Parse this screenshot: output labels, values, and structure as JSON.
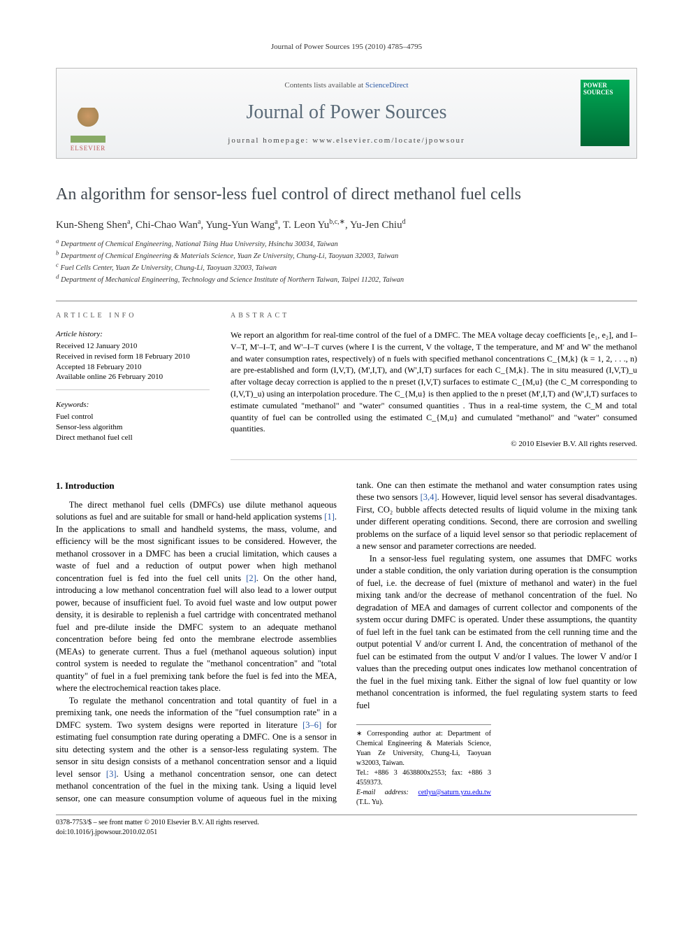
{
  "header": {
    "citation": "Journal of Power Sources 195 (2010) 4785–4795",
    "contents_prefix": "Contents lists available at ",
    "contents_link": "ScienceDirect",
    "journal_name": "Journal of Power Sources",
    "homepage_label": "journal homepage: www.elsevier.com/locate/jpowsour",
    "publisher_logo_text": "ELSEVIER",
    "cover_title": "POWER SOURCES"
  },
  "article": {
    "title": "An algorithm for sensor-less fuel control of direct methanol fuel cells",
    "authors_html": "Kun-Sheng Shen<sup>a</sup>, Chi-Chao Wan<sup>a</sup>, Yung-Yun Wang<sup>a</sup>, T. Leon Yu<sup>b,c,∗</sup>, Yu-Jen Chiu<sup>d</sup>",
    "affiliations": [
      "a Department of Chemical Engineering, National Tsing Hua University, Hsinchu 30034, Taiwan",
      "b Department of Chemical Engineering & Materials Science, Yuan Ze University, Chung-Li, Taoyuan 32003, Taiwan",
      "c Fuel Cells Center, Yuan Ze University, Chung-Li, Taoyuan 32003, Taiwan",
      "d Department of Mechanical Engineering, Technology and Science Institute of Northern Taiwan, Taipei 11202, Taiwan"
    ]
  },
  "info": {
    "heading": "ARTICLE INFO",
    "history_label": "Article history:",
    "history": [
      "Received 12 January 2010",
      "Received in revised form 18 February 2010",
      "Accepted 18 February 2010",
      "Available online 26 February 2010"
    ],
    "keywords_label": "Keywords:",
    "keywords": [
      "Fuel control",
      "Sensor-less algorithm",
      "Direct methanol fuel cell"
    ]
  },
  "abstract": {
    "heading": "ABSTRACT",
    "body": "We report an algorithm for real-time control of the fuel of a DMFC. The MEA voltage decay coefficients [e₁, e₂], and I–V–T, M'–I–T, and W'–I–T curves (where I is the current, V the voltage, T the temperature, and M' and W' the methanol and water consumption rates, respectively) of n fuels with specified methanol concentrations C_{M,k} (k = 1, 2, . . ., n) are pre-established and form (I,V,T), (M',I,T), and (W',I,T) surfaces for each C_{M,k}. The in situ measured (I,V,T)_u after voltage decay correction is applied to the n preset (I,V,T) surfaces to estimate C_{M,u} (the C_M corresponding to (I,V,T)_u) using an interpolation procedure. The C_{M,u} is then applied to the n preset (M',I,T) and (W',I,T) surfaces to estimate cumulated \"methanol\" and \"water\" consumed quantities . Thus in a real-time system, the C_M and total quantity of fuel can be controlled using the estimated C_{M,u} and cumulated \"methanol\" and \"water\" consumed quantities.",
    "copyright": "© 2010 Elsevier B.V. All rights reserved."
  },
  "body": {
    "section1_heading": "1.  Introduction",
    "p1": "The direct methanol fuel cells (DMFCs) use dilute methanol aqueous solutions as fuel and are suitable for small or hand-held application systems [1]. In the applications to small and handheld systems, the mass, volume, and efficiency will be the most significant issues to be considered. However, the methanol crossover in a DMFC has been a crucial limitation, which causes a waste of fuel and a reduction of output power when high methanol concentration fuel is fed into the fuel cell units [2]. On the other hand, introducing a low methanol concentration fuel will also lead to a lower output power, because of insufficient fuel. To avoid fuel waste and low output power density, it is desirable to replenish a fuel cartridge with concentrated methanol fuel and pre-dilute inside the DMFC system to an adequate methanol concentration before being fed onto the membrane electrode assemblies (MEAs) to generate current. Thus a fuel (methanol aqueous solution) input control system is needed to regulate the \"methanol concentration\" and \"total quantity\" of fuel in a fuel premixing tank before the fuel is fed into the MEA, where the electrochemical reaction takes place.",
    "p2": "To regulate the methanol concentration and total quantity of fuel in a premixing tank, one needs the information of the \"fuel consumption rate\" in a DMFC system. Two system designs were reported in literature [3–6] for estimating fuel consumption rate during operating a DMFC. One is a sensor in situ detecting system and the other is a sensor-less regulating system. The sensor in situ design consists of a methanol concentration sensor and a liquid level sensor [3]. Using a methanol concentration sensor, one can detect methanol concentration of the fuel in the mixing tank. Using a liquid level sensor, one can measure consumption volume of aqueous fuel in the mixing tank. One can then estimate the methanol and water consumption rates using these two sensors [3,4]. However, liquid level sensor has several disadvantages. First, CO₂ bubble affects detected results of liquid volume in the mixing tank under different operating conditions. Second, there are corrosion and swelling problems on the surface of a liquid level sensor so that periodic replacement of a new sensor and parameter corrections are needed.",
    "p3": "In a sensor-less fuel regulating system, one assumes that DMFC works under a stable condition, the only variation during operation is the consumption of fuel, i.e. the decrease of fuel (mixture of methanol and water) in the fuel mixing tank and/or the decrease of methanol concentration of the fuel. No degradation of MEA and damages of current collector and components of the system occur during DMFC is operated. Under these assumptions, the quantity of fuel left in the fuel tank can be estimated from the cell running time and the output potential V and/or current I. And, the concentration of methanol of the fuel can be estimated from the output V and/or I values. The lower V and/or I values than the preceding output ones indicates low methanol concentration of the fuel in the fuel mixing tank. Either the signal of low fuel quantity or low methanol concentration is informed, the fuel regulating system starts to feed fuel"
  },
  "footnotes": {
    "corr": "∗ Corresponding author at: Department of Chemical Engineering & Materials Science, Yuan Ze University, Chung-Li, Taoyuan w32003, Taiwan.",
    "tel": "Tel.: +886 3 4638800x2553; fax: +886 3 4559373.",
    "email_label": "E-mail address: ",
    "email": "cetlyu@saturn.yzu.edu.tw",
    "email_who": " (T.L. Yu)."
  },
  "doi": {
    "line1": "0378-7753/$ – see front matter © 2010 Elsevier B.V. All rights reserved.",
    "line2": "doi:10.1016/j.jpowsour.2010.02.051"
  }
}
